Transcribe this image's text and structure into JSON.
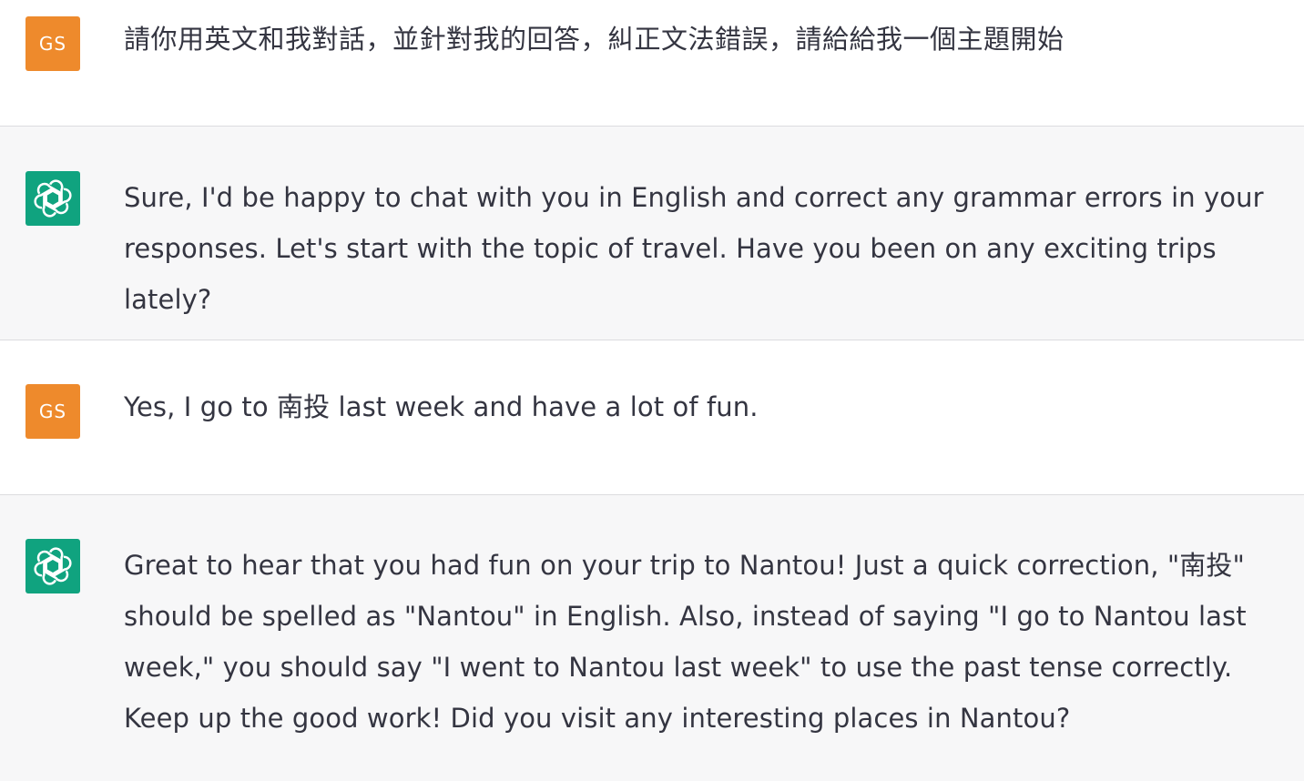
{
  "conversation": {
    "messages": [
      {
        "role": "user",
        "avatar_initials": "GS",
        "text": "請你用英文和我對話，並針對我的回答，糾正文法錯誤，請給給我一個主題開始"
      },
      {
        "role": "assistant",
        "avatar_icon": "openai-logo-icon",
        "text": "Sure, I'd be happy to chat with you in English and correct any grammar errors in your responses. Let's start with the topic of travel. Have you been on any exciting trips lately?"
      },
      {
        "role": "user",
        "avatar_initials": "GS",
        "text": "Yes, I go to 南投 last week and have a lot of fun."
      },
      {
        "role": "assistant",
        "avatar_icon": "openai-logo-icon",
        "text": "Great to hear that you had fun on your trip to Nantou! Just a quick correction, \"南投\" should be spelled as \"Nantou\" in English. Also, instead of saying \"I go to Nantou last week,\" you should say \"I went to Nantou last week\" to use the past tense correctly. Keep up the good work! Did you visit any interesting places in Nantou?"
      }
    ]
  },
  "colors": {
    "user_avatar_bg": "#ee8a2c",
    "assistant_avatar_bg": "#10a37f",
    "assistant_row_bg": "#f7f7f8",
    "text": "#343541"
  }
}
